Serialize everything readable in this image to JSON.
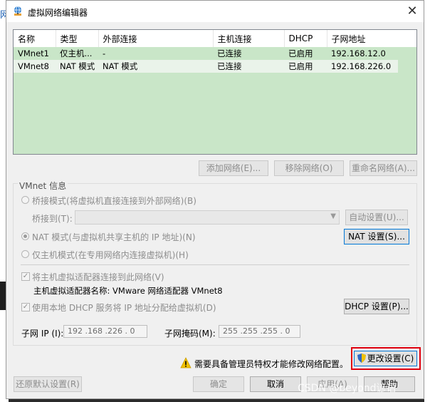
{
  "window": {
    "title": "虚拟网络编辑器",
    "close_glyph": "✕"
  },
  "table": {
    "headers": [
      "名称",
      "类型",
      "外部连接",
      "主机连接",
      "DHCP",
      "子网地址"
    ],
    "rows": [
      [
        "VMnet1",
        "仅主机...",
        "-",
        "已连接",
        "已启用",
        "192.168.12.0"
      ],
      [
        "VMnet8",
        "NAT 模式",
        "NAT 模式",
        "已连接",
        "已启用",
        "192.168.226.0"
      ]
    ]
  },
  "list_buttons": {
    "add": "添加网络(E)...",
    "remove": "移除网络(O)",
    "rename": "重命名网络(A)..."
  },
  "vmnet_info": {
    "title": "VMnet 信息",
    "bridged": "桥接模式(将虚拟机直接连接到外部网络)(B)",
    "bridged_to": "桥接到(T):",
    "auto_settings": "自动设置(U)...",
    "nat": "NAT 模式(与虚拟机共享主机的 IP 地址)(N)",
    "nat_settings": "NAT 设置(S)...",
    "host_only": "仅主机模式(在专用网络内连接虚拟机)(H)",
    "connect_adapter": "将主机虚拟适配器连接到此网络(V)",
    "adapter_name": "主机虚拟适配器名称: VMware 网络适配器 VMnet8",
    "use_dhcp": "使用本地 DHCP 服务将 IP 地址分配给虚拟机(D)",
    "dhcp_settings": "DHCP 设置(P)...",
    "subnet_ip_label": "子网 IP (I):",
    "subnet_ip": "192 .168 .226 .  0",
    "subnet_mask_label": "子网掩码(M):",
    "subnet_mask": "255 .255 .255 .  0",
    "check_glyph": "✓"
  },
  "admin": {
    "notice": "需要具备管理员特权才能修改网络配置。",
    "change_settings": "更改设置(C)"
  },
  "footer": {
    "restore": "还原默认设置(R)",
    "ok": "确定",
    "cancel": "取消",
    "apply": "应用(A)",
    "help": "帮助"
  },
  "watermark": "CSDN @beyond谚语",
  "background": {
    "left_fragment": "网"
  },
  "colors": {
    "list_bg": "#c9e6c8",
    "highlight": "#e0000d",
    "focus": "#0078d7"
  },
  "icons": {
    "window": "network-globe-icon",
    "warning": "warning-icon",
    "shield": "uac-shield-icon"
  }
}
